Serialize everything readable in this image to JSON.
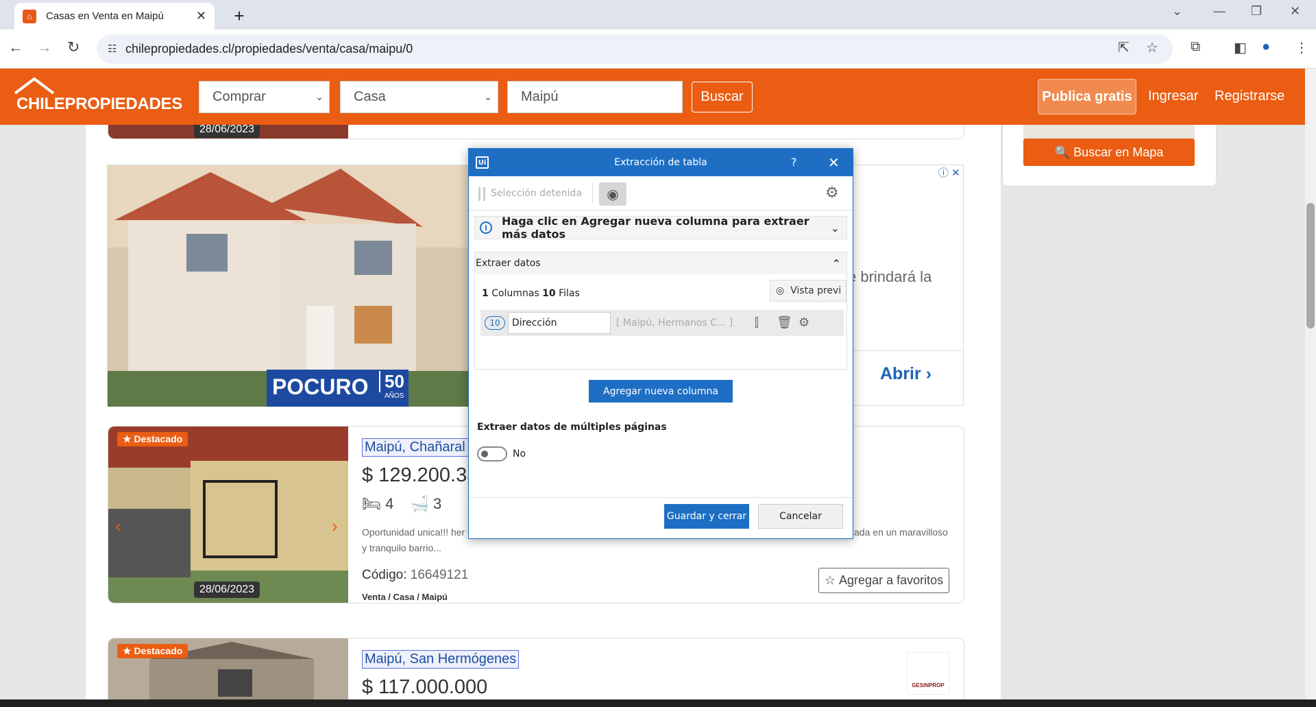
{
  "browser": {
    "tab_title": "Casas en Venta en Maipú",
    "url": "chilepropiedades.cl/propiedades/venta/casa/maipu/0"
  },
  "site": {
    "logo": "CHILEPROPIEDADES",
    "operation_select": "Comprar",
    "type_select": "Casa",
    "location_input": "Maipú",
    "search_button": "Buscar",
    "publish_button": "Publica gratis",
    "login_link": "Ingresar",
    "register_link": "Registrarse",
    "map_button": "Buscar en Mapa"
  },
  "ad": {
    "brand": "POCURO",
    "years": "50",
    "years_label": "AÑOS",
    "text": "e brindará la",
    "open_link": "Abrir"
  },
  "listings": [
    {
      "badge": "Destacado",
      "address": "Maipú, Chañaral 5",
      "price": "$ 129.200.33",
      "beds": "4",
      "baths": "3",
      "description": "Oportunidad unica!!! her",
      "description_right": "ada en un maravilloso",
      "description_line2": "y tranquilo barrio...",
      "code_label": "Código:",
      "code": "16649121",
      "breadcrumb": "Venta / Casa / Maipú",
      "fav_button": "Agregar a favoritos",
      "date": "28/06/2023"
    },
    {
      "badge": "Destacado",
      "address": "Maipú, San Hermógenes",
      "price": "$ 117.000.000",
      "agency": "GESINPROP"
    }
  ],
  "top_card_date": "28/06/2023",
  "modal": {
    "title": "Extracción de tabla",
    "help": "?",
    "selection_status": "Selección detenida",
    "info_message": "Haga clic en Agregar nueva columna para extraer más datos",
    "section_title": "Extraer datos",
    "columns_count": "1",
    "columns_label": "Columnas",
    "rows_count": "10",
    "rows_label": "Filas",
    "preview_button": "Vista previ",
    "column": {
      "count": "10",
      "name": "Dirección",
      "sample": "[ Maipú, Hermanos C... ]"
    },
    "add_column_button": "Agregar nueva columna",
    "multi_page_label": "Extraer datos de múltiples páginas",
    "multi_page_value": "No",
    "save_button": "Guardar y cerrar",
    "cancel_button": "Cancelar"
  }
}
